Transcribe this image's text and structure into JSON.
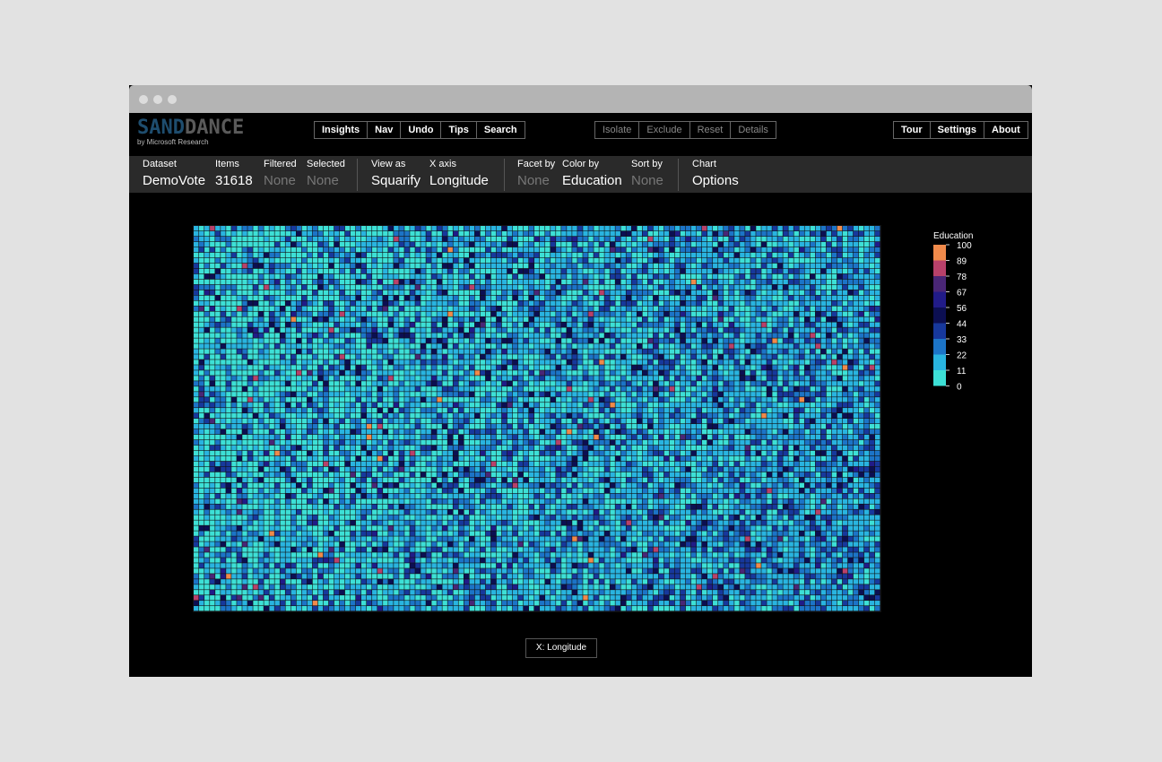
{
  "app": {
    "logo_sand": "SAND",
    "logo_dance": "DANCE",
    "logo_sub": "by Microsoft Research"
  },
  "toolbar_left": [
    "Insights",
    "Nav",
    "Undo",
    "Tips",
    "Search"
  ],
  "toolbar_mid": [
    "Isolate",
    "Exclude",
    "Reset",
    "Details"
  ],
  "toolbar_right": [
    "Tour",
    "Settings",
    "About"
  ],
  "props": {
    "dataset": {
      "label": "Dataset",
      "value": "DemoVote"
    },
    "items": {
      "label": "Items",
      "value": "31618"
    },
    "filtered": {
      "label": "Filtered",
      "value": "None"
    },
    "selected": {
      "label": "Selected",
      "value": "None"
    },
    "view_as": {
      "label": "View as",
      "value": "Squarify"
    },
    "x_axis": {
      "label": "X axis",
      "value": "Longitude"
    },
    "facet_by": {
      "label": "Facet by",
      "value": "None"
    },
    "color_by": {
      "label": "Color by",
      "value": "Education"
    },
    "sort_by": {
      "label": "Sort by",
      "value": "None"
    },
    "chart": {
      "label": "Chart",
      "value": "Options"
    }
  },
  "x_axis_button": "X: Longitude",
  "colors": {
    "c0": "#3de0d6",
    "c11": "#29b4e0",
    "c22": "#1c74c7",
    "c33": "#17389c",
    "c44": "#0c0f52",
    "c56": "#211b88",
    "c67": "#4a2676",
    "c78": "#b8416a",
    "c89": "#f08a4b"
  },
  "chart_data": {
    "type": "heatmap",
    "title": "",
    "legend": {
      "title": "Education",
      "ticks": [
        "100",
        "89",
        "78",
        "67",
        "56",
        "44",
        "33",
        "22",
        "11",
        "0"
      ],
      "position": "right"
    },
    "color_range": [
      0,
      100
    ],
    "columns": 127,
    "rows": 72,
    "trend": "higher Education values become more frequent toward the right (east)"
  }
}
